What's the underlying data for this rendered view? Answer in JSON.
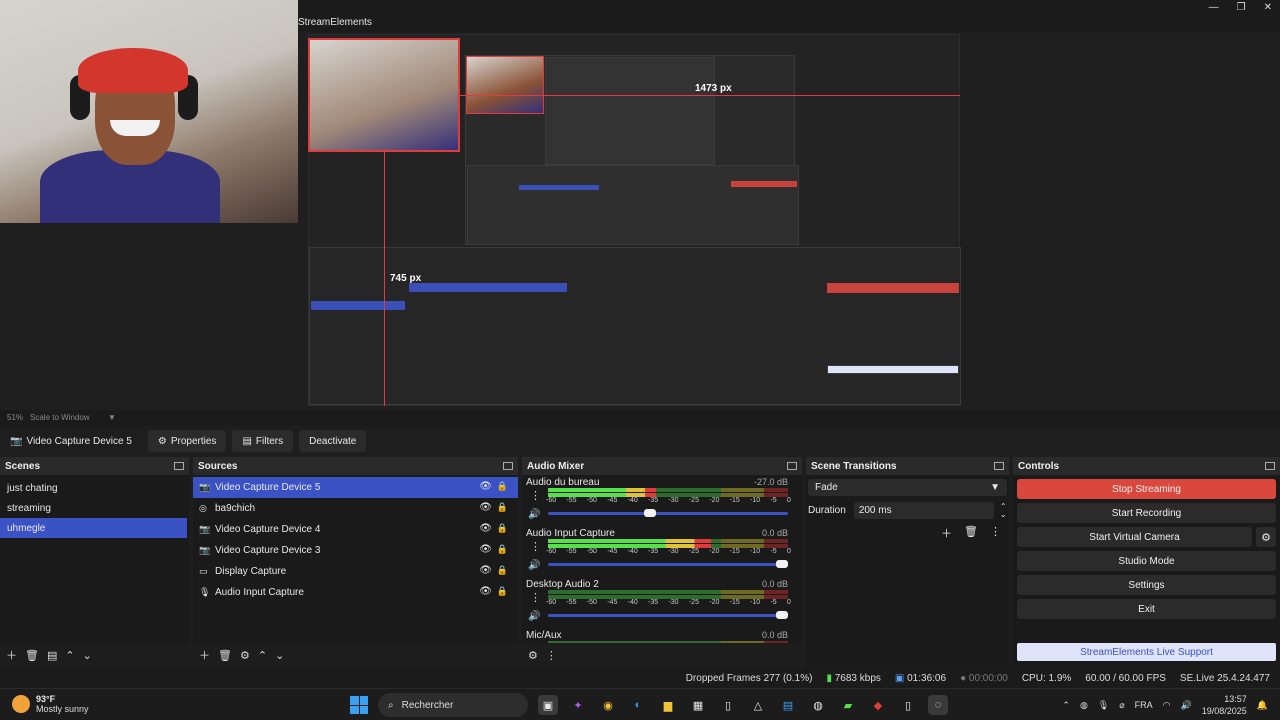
{
  "window": {
    "title": "StreamElements",
    "controls": [
      "—",
      "❐",
      "✕"
    ]
  },
  "preview": {
    "measure_width": "1473 px",
    "measure_height": "745 px",
    "zoom_label": "51%",
    "scale_label": "Scale to Window"
  },
  "source_toolbar": {
    "source_name": "Video Capture Device 5",
    "properties_label": "Properties",
    "filters_label": "Filters",
    "deactivate_label": "Deactivate"
  },
  "scenes": {
    "title": "Scenes",
    "items": [
      {
        "label": "just chating"
      },
      {
        "label": "streaming"
      },
      {
        "label": "uhmegle"
      }
    ]
  },
  "sources": {
    "title": "Sources",
    "items": [
      {
        "label": "Video Capture Device 5",
        "icon": "camera-icon"
      },
      {
        "label": "ba9chich",
        "icon": "browser-icon"
      },
      {
        "label": "Video Capture Device 4",
        "icon": "camera-icon"
      },
      {
        "label": "Video Capture Device 3",
        "icon": "camera-icon"
      },
      {
        "label": "Display Capture",
        "icon": "monitor-icon"
      },
      {
        "label": "Audio Input Capture",
        "icon": "microphone-icon"
      }
    ]
  },
  "mixer": {
    "title": "Audio Mixer",
    "scale": [
      "-60",
      "-55",
      "-50",
      "-45",
      "-40",
      "-35",
      "-30",
      "-25",
      "-20",
      "-15",
      "-10",
      "-5",
      "0"
    ],
    "channels": [
      {
        "name": "Audio du bureau",
        "db": "-27.0 dB",
        "level": 0.45,
        "volume": 0.45
      },
      {
        "name": "Audio Input Capture",
        "db": "0.0 dB",
        "level": 0.68,
        "volume": 1.0
      },
      {
        "name": "Desktop Audio 2",
        "db": "0.0 dB",
        "level": 0.0,
        "volume": 1.0
      },
      {
        "name": "Mic/Aux",
        "db": "0.0 dB",
        "level": 0.0,
        "volume": 1.0
      }
    ]
  },
  "transitions": {
    "title": "Scene Transitions",
    "selected": "Fade",
    "duration_label": "Duration",
    "duration_value": "200 ms"
  },
  "controls": {
    "title": "Controls",
    "stop_streaming": "Stop Streaming",
    "start_recording": "Start Recording",
    "start_virtual_camera": "Start Virtual Camera",
    "studio_mode": "Studio Mode",
    "settings": "Settings",
    "exit": "Exit",
    "support": "StreamElements Live Support"
  },
  "status": {
    "dropped_frames": "Dropped Frames 277 (0.1%)",
    "bitrate": "7683 kbps",
    "stream_time": "01:36:06",
    "record_time": "00:00:00",
    "cpu": "CPU: 1.9%",
    "fps": "60.00 / 60.00 FPS",
    "version": "SE.Live 25.4.24.477"
  },
  "taskbar": {
    "temperature": "93°F",
    "weather": "Mostly sunny",
    "search_placeholder": "Rechercher",
    "language": "FRA",
    "time": "13:57",
    "date": "19/08/2025"
  },
  "colors": {
    "accent": "#3b52c4",
    "stop": "#d9473d",
    "selection": "#e23b3b"
  }
}
